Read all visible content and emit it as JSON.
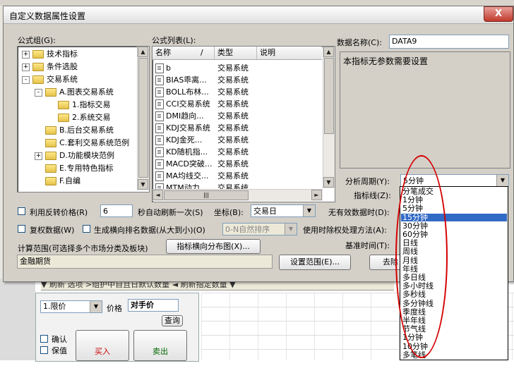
{
  "background": {
    "tab_strip": "▼ 刷新 选项 >组护中自且日默认数量 ◄ 刷新指定数量 ▼",
    "order_type": "1.限价",
    "price_label": "价格",
    "price_value": "对手价",
    "query_button": "查询",
    "confirm_label": "确认",
    "keep_label": "保值",
    "buy_label": "买入",
    "sell_label": "卖出"
  },
  "dialog": {
    "title": "自定义数据属性设置",
    "close": "X",
    "formula_group_label": "公式组(G):",
    "formula_list_label": "公式列表(L):",
    "data_name_label": "数据名称(C):",
    "data_name_value": "DATA9",
    "param_text": "本指标无参数需要设置",
    "tree": [
      {
        "label": "技术指标",
        "level": 0,
        "expander": "+"
      },
      {
        "label": "条件选股",
        "level": 0,
        "expander": "+"
      },
      {
        "label": "交易系统",
        "level": 0,
        "expander": "-"
      },
      {
        "label": "A.图表交易系统",
        "level": 1,
        "expander": "-"
      },
      {
        "label": "1.指标交易",
        "level": 2,
        "expander": ""
      },
      {
        "label": "2.系统交易",
        "level": 2,
        "expander": ""
      },
      {
        "label": "B.后台交易系统",
        "level": 1,
        "expander": ""
      },
      {
        "label": "C.套利交易系统范例",
        "level": 1,
        "expander": ""
      },
      {
        "label": "D.功能模块范例",
        "level": 1,
        "expander": "+"
      },
      {
        "label": "E.专用特色指标",
        "level": 1,
        "expander": ""
      },
      {
        "label": "F.自编",
        "level": 1,
        "expander": ""
      }
    ],
    "list_columns": [
      "名称",
      "/",
      "类型",
      "说明"
    ],
    "list_rows": [
      {
        "name": "b",
        "type": "交易系统"
      },
      {
        "name": "BIAS乖离...",
        "type": "交易系统"
      },
      {
        "name": "BOLL布林...",
        "type": "交易系统"
      },
      {
        "name": "CCI交易系统",
        "type": "交易系统"
      },
      {
        "name": "DMI趋向...",
        "type": "交易系统"
      },
      {
        "name": "KDJ交易系统",
        "type": "交易系统"
      },
      {
        "name": "KDJ金死...",
        "type": "交易系统"
      },
      {
        "name": "KD随机指...",
        "type": "交易系统"
      },
      {
        "name": "MACD突破...",
        "type": "交易系统"
      },
      {
        "name": "MA均线交...",
        "type": "交易系统"
      },
      {
        "name": "MTM动力...",
        "type": "交易系统"
      }
    ],
    "period_label": "分析周期(Y):",
    "period_value": "5分钟",
    "indicator_line_label": "指标线(Z):",
    "reverse_price_label": "利用反转价格(R)",
    "refresh_value": "6",
    "refresh_label": "秒自动刷新一次(S)",
    "axis_label": "坐标(B):",
    "axis_value": "交易日",
    "no_valid_label": "无有效数据时(D):",
    "restore_label": "复权数据(W)",
    "rank_label": "生成横向排名数据(从大到小)(O)",
    "rank_value": "0-N自然排序",
    "weight_label": "使用时除权处理方法(A):",
    "range_label": "计算范围(可选择多个市场分类及板块)",
    "distribution_button": "指标横向分布图(X)...",
    "base_time_label": "基准时间(T):",
    "range_value": "金融期货",
    "set_range_button": "设置范围(E)...",
    "remove_button": "去除"
  },
  "dropdown": {
    "selected_index": 3,
    "options": [
      "分笔成交",
      "1分钟",
      "5分钟",
      "15分钟",
      "30分钟",
      "60分钟",
      "日线",
      "周线",
      "月线",
      "年线",
      "多日线",
      "多小时线",
      "多秒线",
      "多分钟线",
      "季度线",
      "半年线",
      "节气线",
      "1分钟",
      "10分钟",
      "多笔线"
    ]
  },
  "colors": {
    "dialog_bg": "#d4d0c8",
    "selection": "#316ac5",
    "annotation": "#d40000"
  }
}
